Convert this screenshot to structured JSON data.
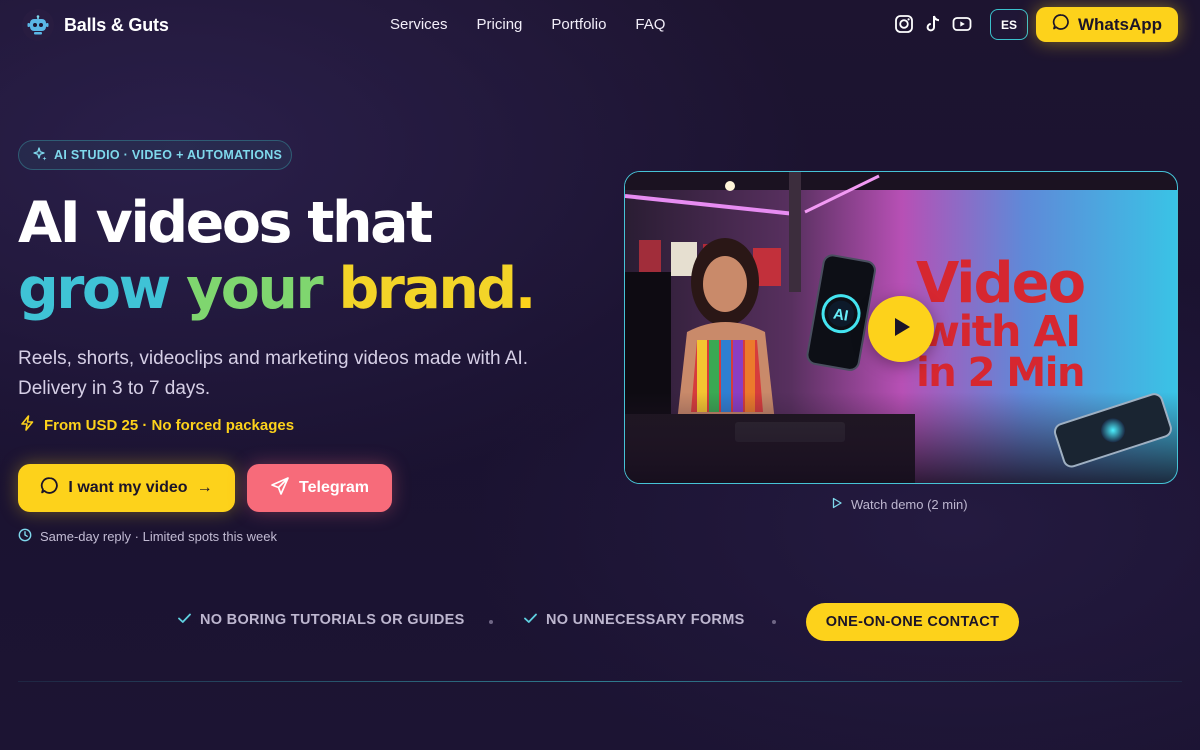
{
  "brand": {
    "name": "Balls & Guts",
    "logo_icon": "robot-icon"
  },
  "nav": {
    "links": [
      "Services",
      "Pricing",
      "Portfolio",
      "FAQ"
    ],
    "social_icons": [
      "instagram-icon",
      "tiktok-icon",
      "youtube-icon"
    ],
    "lang_label": "ES",
    "whatsapp_label": "WhatsApp"
  },
  "hero": {
    "badge": "AI STUDIO · VIDEO + AUTOMATIONS",
    "headline_line1": "AI videos that",
    "headline_word1": "grow",
    "headline_word2": "your",
    "headline_word3": "brand",
    "headline_dot": ".",
    "subtitle_line1": "Reels, shorts, videoclips and marketing videos made with AI.",
    "subtitle_line2": "Delivery in 3 to 7 days.",
    "price_note": "From USD 25 · No forced packages",
    "cta_primary": "I want my video",
    "cta_primary_arrow": "→",
    "cta_telegram": "Telegram",
    "reply_note": "Same-day reply · Limited spots this week"
  },
  "video": {
    "title_line1": "Video",
    "title_line2": "with AI",
    "title_line3": "in 2 Min",
    "phone_label": "AI",
    "watch_label": "Watch demo (2 min)"
  },
  "features": {
    "item1": "NO BORING TUTORIALS OR GUIDES",
    "item2": "NO UNNECESSARY FORMS",
    "highlight": "ONE-ON-ONE CONTACT"
  },
  "colors": {
    "accent_yellow": "#fdd21b",
    "accent_cyan": "#3fc3d6",
    "accent_green": "#7fd66f",
    "telegram_pink": "#f76b7a",
    "background": "#1c1433"
  }
}
